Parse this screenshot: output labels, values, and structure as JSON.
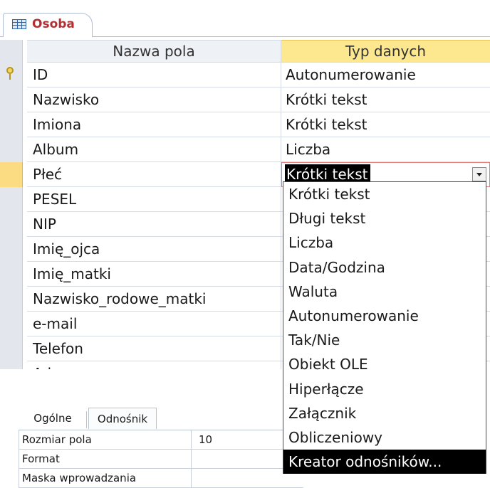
{
  "doc_tab": {
    "label": "Osoba",
    "icon": "table-icon"
  },
  "grid": {
    "headers": {
      "field_name": "Nazwa pola",
      "data_type": "Typ danych"
    },
    "rows": [
      {
        "name": "ID",
        "type": "Autonumerowanie",
        "primary_key": true
      },
      {
        "name": "Nazwisko",
        "type": "Krótki tekst"
      },
      {
        "name": "Imiona",
        "type": "Krótki tekst"
      },
      {
        "name": "Album",
        "type": "Liczba"
      },
      {
        "name": "Płeć",
        "type": "Krótki tekst",
        "current": true
      },
      {
        "name": "PESEL"
      },
      {
        "name": "NIP"
      },
      {
        "name": "Imię_ojca"
      },
      {
        "name": "Imię_matki"
      },
      {
        "name": "Nazwisko_rodowe_matki"
      },
      {
        "name": "e-mail"
      },
      {
        "name": "Telefon"
      },
      {
        "name": "Adres"
      }
    ]
  },
  "dropdown": {
    "items": [
      "Krótki tekst",
      "Długi tekst",
      "Liczba",
      "Data/Godzina",
      "Waluta",
      "Autonumerowanie",
      "Tak/Nie",
      "Obiekt OLE",
      "Hiperłącze",
      "Załącznik",
      "Obliczeniowy",
      "Kreator odnośników..."
    ],
    "highlighted": "Kreator odnośników..."
  },
  "properties": {
    "tabs": [
      {
        "label": "Ogólne",
        "active": true
      },
      {
        "label": "Odnośnik",
        "active": false
      }
    ],
    "rows": [
      {
        "name": "Rozmiar pola",
        "value": "10"
      },
      {
        "name": "Format",
        "value": ""
      },
      {
        "name": "Maska wprowadzania",
        "value": ""
      }
    ]
  },
  "colors": {
    "tab_label": "#b52e31",
    "header_highlight": "#fde88f",
    "selector_active": "#fcdc83",
    "selection_bg": "#000000"
  }
}
